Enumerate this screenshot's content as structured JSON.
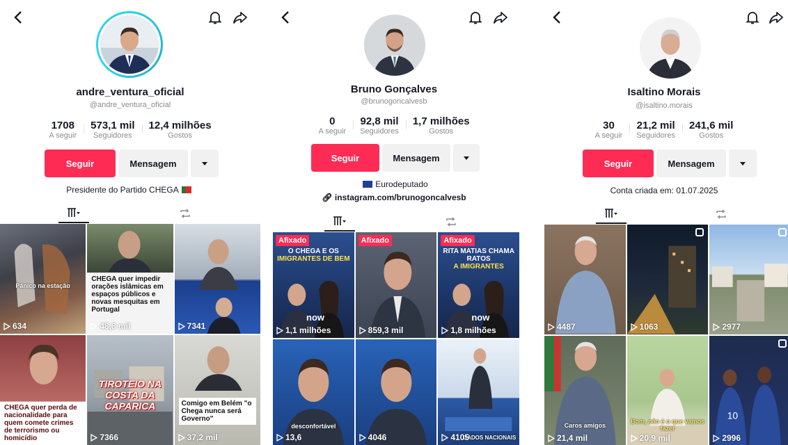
{
  "profiles": [
    {
      "name": "andre_ventura_oficial",
      "handle": "@andre_ventura_oficial",
      "stats": [
        {
          "num": "1708",
          "label": "A seguir"
        },
        {
          "num": "573,1 mil",
          "label": "Seguidores"
        },
        {
          "num": "12,4 milhões",
          "label": "Gostos"
        }
      ],
      "follow_label": "Seguir",
      "message_label": "Mensagem",
      "bio": "Presidente do Partido CHEGA",
      "videos": [
        {
          "views": "634",
          "caption": "Pânico na estação"
        },
        {
          "views": "48,8 mil",
          "caption": "CHEGA quer impedir orações islâmicas em espaços públicos e novas mesquitas em Portugal"
        },
        {
          "views": "7341",
          "caption": ""
        },
        {
          "views": "",
          "caption": "CHEGA quer perda de nacionalidade para quem comete crimes de terrorismo ou homicídio"
        },
        {
          "views": "7366",
          "caption": "TIROTEIO NA COSTA DA CAPARICA"
        },
        {
          "views": "37,2 mil",
          "caption": "Comigo em Belém \"o Chega nunca será Governo\""
        }
      ]
    },
    {
      "name": "Bruno Gonçalves",
      "handle": "@brunogoncalvesb",
      "stats": [
        {
          "num": "0",
          "label": "A seguir"
        },
        {
          "num": "92,8 mil",
          "label": "Seguidores"
        },
        {
          "num": "1,7 milhões",
          "label": "Gostos"
        }
      ],
      "follow_label": "Seguir",
      "message_label": "Mensagem",
      "bio": "Eurodeputado",
      "link": "instagram.com/brunogoncalvesb",
      "pinned_label": "Afixado",
      "videos": [
        {
          "views": "1,1 milhões",
          "headline_a": "O CHEGA E OS",
          "headline_b": "IMIGRANTES DE BEM"
        },
        {
          "views": "859,3 mil",
          "headline_a": "",
          "headline_b": ""
        },
        {
          "views": "1,8 milhões",
          "headline_a": "RITA MATIAS CHAMA RATOS",
          "headline_b": "A IMIGRANTES"
        },
        {
          "views": "13,6",
          "caption": "desconfortável"
        },
        {
          "views": "4046",
          "caption": ""
        },
        {
          "views": "4105",
          "caption": "DADOS NACIONAIS"
        }
      ],
      "now_label": "now"
    },
    {
      "name": "Isaltino Morais",
      "handle": "@isaltino.morais",
      "stats": [
        {
          "num": "30",
          "label": "A seguir"
        },
        {
          "num": "21,2 mil",
          "label": "Seguidores"
        },
        {
          "num": "241,6 mil",
          "label": "Gostos"
        }
      ],
      "follow_label": "Seguir",
      "message_label": "Mensagem",
      "bio": "Conta criada em: 01.07.2025",
      "videos": [
        {
          "views": "4487"
        },
        {
          "views": "1063"
        },
        {
          "views": "2977"
        },
        {
          "views": "21,4 mil",
          "caption": "Caros amigos"
        },
        {
          "views": "20,9 mil",
          "caption": "Bom, não é o que vamos fazer"
        },
        {
          "views": "2996"
        }
      ]
    }
  ],
  "colors": {
    "accent": "#fe2c55",
    "ring": "#25d1e8"
  }
}
